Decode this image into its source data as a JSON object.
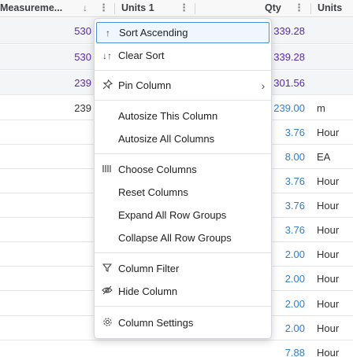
{
  "header": {
    "col_measurement": "Measureme...",
    "col_units1": "Units 1",
    "col_qty": "Qty",
    "col_units": "Units",
    "sort_arrow": "↓",
    "menu_dots": "⋮"
  },
  "rows": [
    {
      "measurement": "530",
      "qty": "339.28",
      "units": ""
    },
    {
      "measurement": "530",
      "qty": "339.28",
      "units": ""
    },
    {
      "measurement": "239",
      "qty": "301.56",
      "units": ""
    },
    {
      "measurement": "239",
      "qty": "239.00",
      "units": "m"
    },
    {
      "measurement": "",
      "qty": "3.76",
      "units": "Hour"
    },
    {
      "measurement": "",
      "qty": "8.00",
      "units": "EA"
    },
    {
      "measurement": "",
      "qty": "3.76",
      "units": "Hour"
    },
    {
      "measurement": "",
      "qty": "3.76",
      "units": "Hour"
    },
    {
      "measurement": "",
      "qty": "3.76",
      "units": "Hour"
    },
    {
      "measurement": "",
      "qty": "2.00",
      "units": "Hour"
    },
    {
      "measurement": "",
      "qty": "2.00",
      "units": "Hour"
    },
    {
      "measurement": "",
      "qty": "2.00",
      "units": "Hour"
    },
    {
      "measurement": "",
      "qty": "2.00",
      "units": "Hour"
    },
    {
      "measurement": "",
      "qty": "7.88",
      "units": "Hour"
    }
  ],
  "menu": {
    "sort_ascending": "Sort Ascending",
    "clear_sort": "Clear Sort",
    "pin_column": "Pin Column",
    "autosize_this": "Autosize This Column",
    "autosize_all": "Autosize All Columns",
    "choose_columns": "Choose Columns",
    "reset_columns": "Reset Columns",
    "expand_groups": "Expand All Row Groups",
    "collapse_groups": "Collapse All Row Groups",
    "column_filter": "Column Filter",
    "hide_column": "Hide Column",
    "column_settings": "Column Settings",
    "submenu_chevron": "›"
  },
  "icons": {
    "sort_asc": "arrow-up-icon",
    "clear_sort": "sort-arrows-icon",
    "pin": "pin-icon",
    "choose_columns": "columns-icon",
    "filter": "filter-icon",
    "hide": "eye-slash-icon",
    "settings": "gear-icon"
  },
  "colors": {
    "purple_text": "#5a28b8",
    "blue_text": "#2f80d1",
    "active_border": "#4a90e2"
  }
}
